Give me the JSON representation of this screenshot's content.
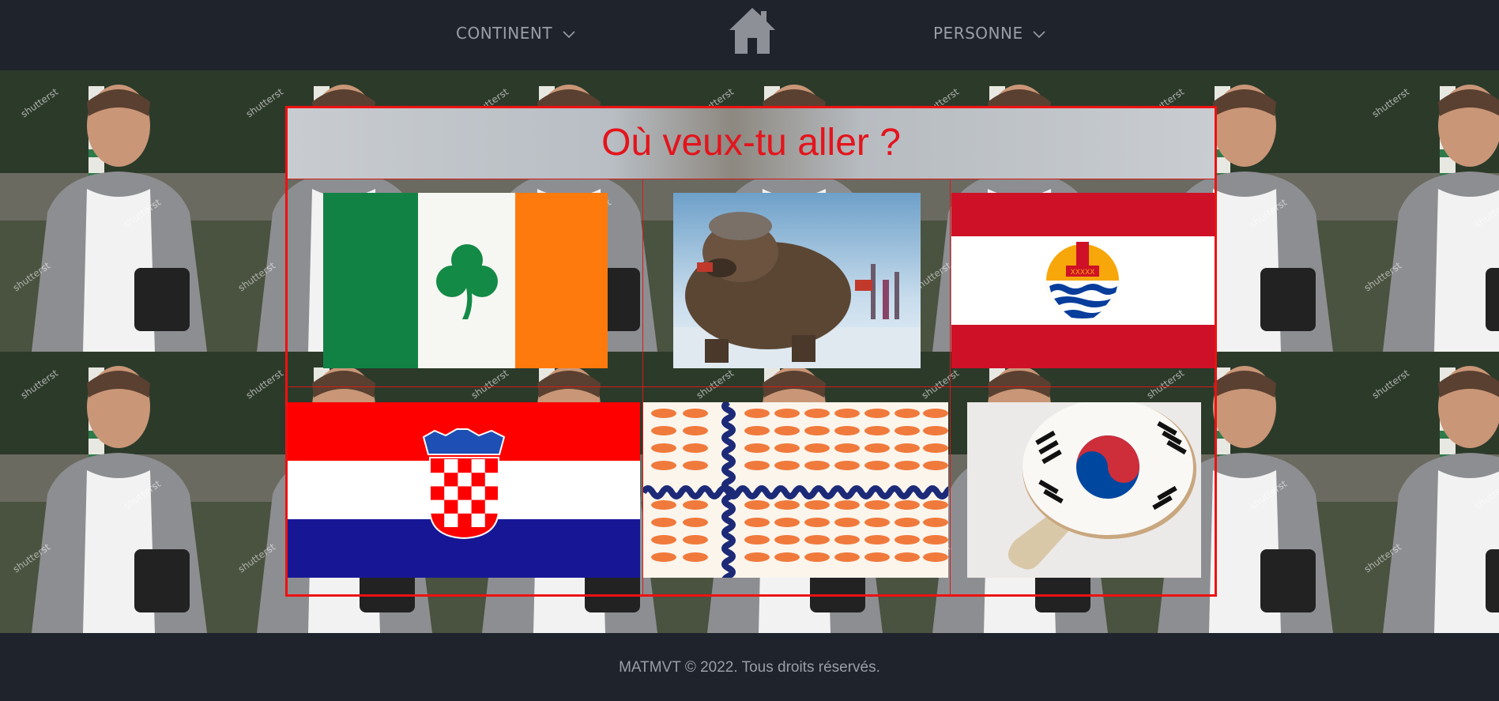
{
  "nav": {
    "continent_label": "CONTINENT",
    "personne_label": "PERSONNE"
  },
  "main": {
    "title": "Où veux-tu aller ?",
    "destinations": [
      {
        "name": "ireland-flag-with-shamrock"
      },
      {
        "name": "russian-bear-image"
      },
      {
        "name": "french-polynesia-flag"
      },
      {
        "name": "croatia-flag"
      },
      {
        "name": "shrimp-flag-image"
      },
      {
        "name": "korean-flag-ping-pong-paddle"
      }
    ]
  },
  "background": {
    "watermark": "shutterstock"
  },
  "footer": {
    "copyright": "MATMVT © 2022. Tous droits réservés."
  },
  "colors": {
    "navbar": "#1f232b",
    "accent_red": "#e4141c",
    "nav_text": "#9a9ea6"
  }
}
